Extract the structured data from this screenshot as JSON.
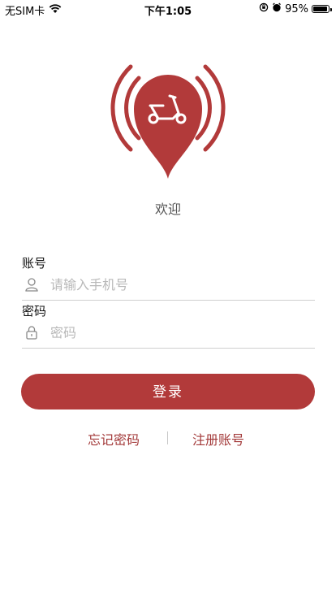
{
  "status_bar": {
    "carrier": "无SIM卡",
    "time": "下午1:05",
    "battery_percent": "95%",
    "battery_level": 0.95
  },
  "logo": {
    "icon": "scooter-location-pin-icon",
    "brand_color": "#b23a3a"
  },
  "welcome_text": "欢迎",
  "form": {
    "account": {
      "label": "账号",
      "placeholder": "请输入手机号",
      "icon": "user-icon"
    },
    "password": {
      "label": "密码",
      "placeholder": "密码",
      "icon": "lock-icon"
    }
  },
  "login_button": "登录",
  "links": {
    "forgot_password": "忘记密码",
    "register": "注册账号"
  },
  "colors": {
    "accent": "#b23a3a",
    "link": "#a33a3a",
    "placeholder": "#b8b8b8"
  }
}
